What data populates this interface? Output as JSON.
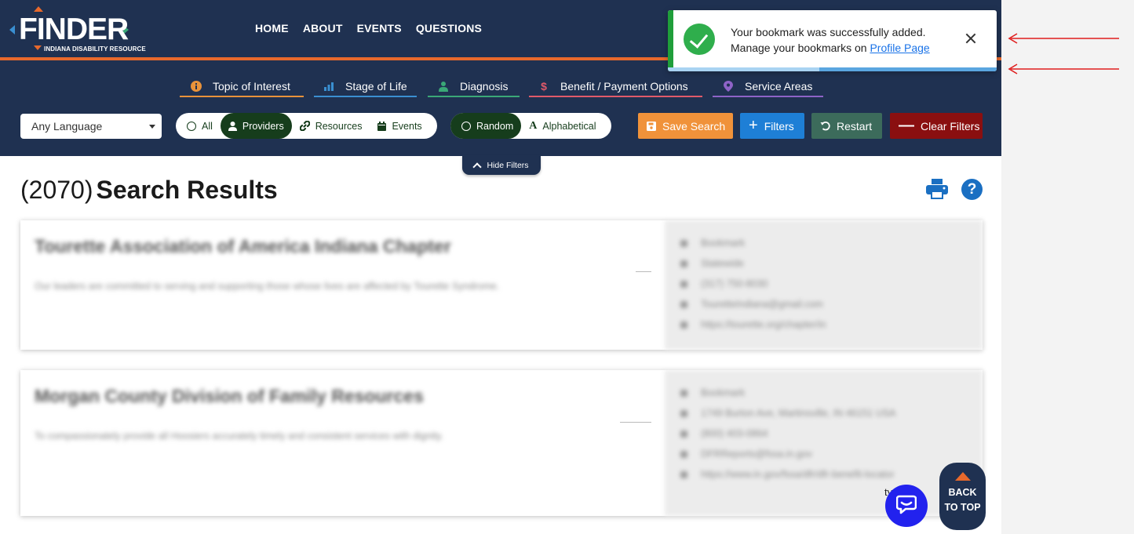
{
  "header": {
    "logo_text": "FINDER",
    "logo_subtitle": "INDIANA DISABILITY RESOURCE",
    "nav": [
      "HOME",
      "ABOUT",
      "EVENTS",
      "QUESTIONS"
    ]
  },
  "categories": [
    {
      "label": "Topic of Interest",
      "icon": "info-circle-icon",
      "color": "#e8923a"
    },
    {
      "label": "Stage of Life",
      "icon": "bar-chart-icon",
      "color": "#3a8fd1"
    },
    {
      "label": "Diagnosis",
      "icon": "doctor-icon",
      "color": "#3aa877"
    },
    {
      "label": "Benefit / Payment Options",
      "icon": "dollar-icon",
      "color": "#e05a6a"
    },
    {
      "label": "Service Areas",
      "icon": "map-pin-icon",
      "color": "#8e63c7"
    }
  ],
  "filters": {
    "language": "Any Language",
    "type_options": [
      "All",
      "Providers",
      "Resources",
      "Events"
    ],
    "type_selected": "Providers",
    "sort_options": [
      "Random",
      "Alphabetical"
    ],
    "sort_selected": "Random",
    "buttons": {
      "save_search": "Save Search",
      "filters": "Filters",
      "restart": "Restart",
      "clear_filters": "Clear Filters"
    },
    "hide_filters": "Hide Filters"
  },
  "results": {
    "count": "(2070)",
    "label": "Search Results",
    "cards": [
      {
        "name": "Tourette Association of America Indiana Chapter",
        "description": "Our leaders are committed to serving and supporting those whose lives are affected by Tourette Syndrome.",
        "details": [
          "Bookmark",
          "Statewide",
          "(317) 750-8030",
          "TouretteIndiana@gmail.com",
          "https://tourette.org/chapter/in"
        ]
      },
      {
        "name": "Morgan County Division of Family Resources",
        "description": "To compassionately provide all Hoosiers accurately timely and consistent services with dignity.",
        "details": [
          "Bookmark",
          "1749 Burton Ave, Martinsville, IN 46151 USA",
          "(800) 403-0864",
          "DFRReports@fssa.in.gov",
          "https://www.in.gov/fssa/dfr/dfr-benefit-locator"
        ]
      }
    ]
  },
  "toast": {
    "line1": "Your bookmark was successfully added.",
    "line2_prefix": "Manage your bookmarks on ",
    "link": "Profile Page",
    "progress_fraction": 0.46
  },
  "widgets": {
    "back_to_top_line1": "BACK",
    "back_to_top_line2": "TO TOP",
    "stray_text": "ty"
  },
  "colors": {
    "navy": "#1f3151",
    "orange": "#e8692c",
    "dark_green": "#163d1c",
    "save": "#f0923a",
    "filters": "#1e7fd6",
    "restart": "#3c6b5b",
    "clear": "#8a0f10",
    "annotation_arrow": "#e01e1e"
  }
}
